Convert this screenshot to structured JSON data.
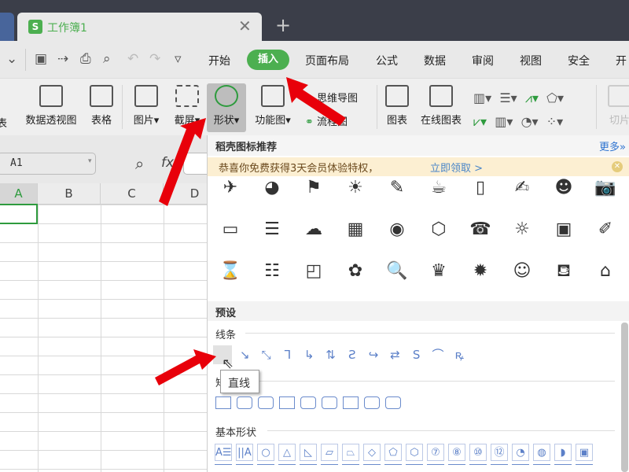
{
  "titlebar": {
    "tab_title": "工作簿1",
    "logo": "S",
    "close": "✕",
    "new_tab": "+"
  },
  "quick_access": [
    "save-icon",
    "export-icon",
    "print-icon",
    "preview-icon",
    "undo-icon",
    "redo-icon",
    "more-icon"
  ],
  "menu": [
    {
      "label": "开始"
    },
    {
      "label": "插入",
      "active": true
    },
    {
      "label": "页面布局"
    },
    {
      "label": "公式"
    },
    {
      "label": "数据"
    },
    {
      "label": "审阅"
    },
    {
      "label": "视图"
    },
    {
      "label": "安全"
    },
    {
      "label": "开"
    }
  ],
  "ribbon": {
    "left": [
      "表",
      "数据透视图",
      "表格",
      "图片",
      "截屏",
      "形状",
      "功能图"
    ],
    "mind": "思维导图",
    "flow": "流程图",
    "chart": "图表",
    "online_chart": "在线图表",
    "slicer": "切片"
  },
  "formula": {
    "name_box": "A1",
    "fx": "fx"
  },
  "columns": [
    "A",
    "B",
    "C",
    "D"
  ],
  "panel": {
    "header": "稻壳图标推荐",
    "more": "更多»",
    "banner_text": "恭喜你免费获得3天会员体验特权，",
    "banner_link": "立即领取 >",
    "icons": [
      "✈",
      "◕",
      "⚑",
      "☀",
      "✎",
      "☕",
      "▯",
      "✍",
      "☻",
      "📷",
      "▭",
      "☰",
      "☁",
      "▦",
      "◉",
      "⬡",
      "☎",
      "☼",
      "▣",
      "✐",
      "⌛",
      "☷",
      "◰",
      "✿",
      "🔍",
      "♛",
      "✹",
      "☺",
      "⛾",
      "⌂"
    ],
    "preset": "预设",
    "lines_label": "线条",
    "lines": [
      "╲",
      "↘",
      "⤡",
      "⅂",
      "↳",
      "⇅",
      "Ƨ",
      "↪",
      "⇄",
      "S",
      "⌒",
      "ꝶ"
    ],
    "tooltip": "直线",
    "rect_label": "矩形",
    "rects": 9,
    "basic_label": "基本形状",
    "basic": [
      "A☰",
      "||A",
      "○",
      "△",
      "◺",
      "▱",
      "⏢",
      "◇",
      "⬠",
      "⬡",
      "⑦",
      "⑧",
      "⑩",
      "⑫",
      "◔",
      "◍",
      "◗",
      "▣"
    ]
  },
  "colors": {
    "accent": "#4caf50",
    "link": "#2f74d0",
    "arrow": "#e8000a"
  }
}
